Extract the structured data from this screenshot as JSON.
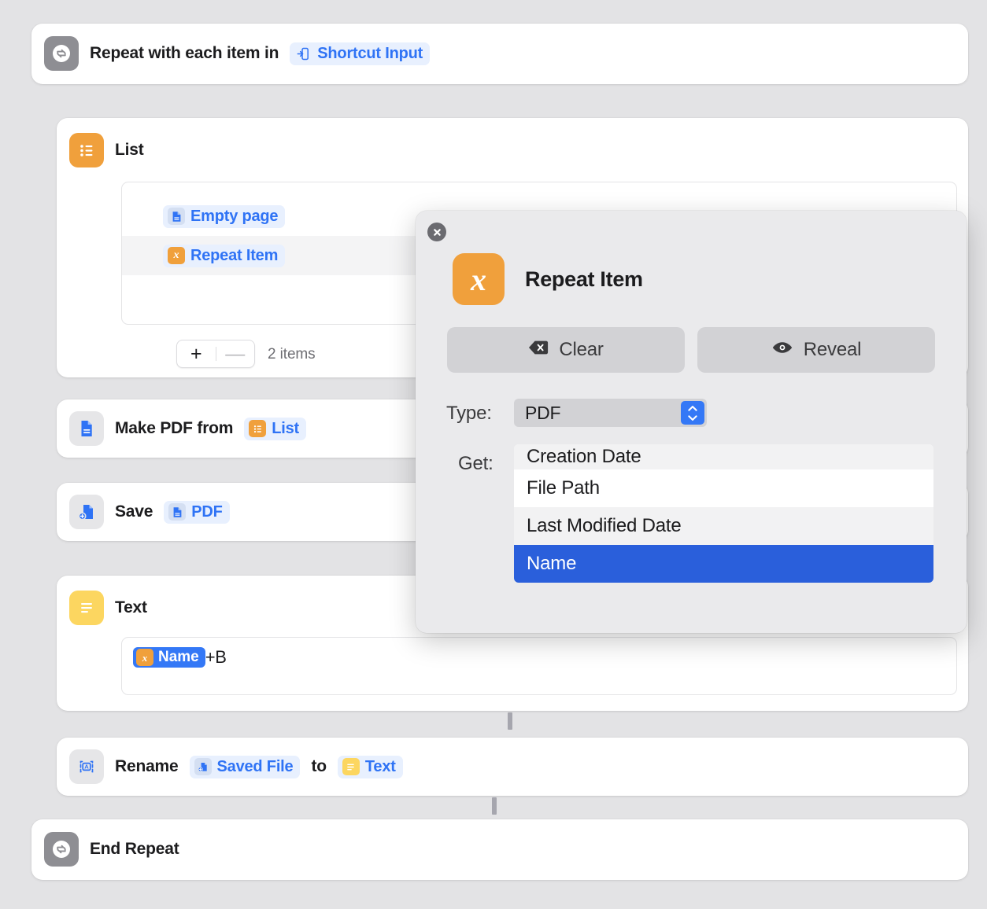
{
  "theme": {
    "page_bg": "#e3e3e5",
    "accent_blue": "#3478f6",
    "token_blue": "#2f73f5",
    "selection_blue": "#2a5fdb",
    "orange": "#f0a03c",
    "yellow": "#fcd660",
    "gray": "#8e8e93"
  },
  "actions": {
    "repeat_start": {
      "label": "Repeat with each item in",
      "icon": "repeat-icon",
      "token": {
        "label": "Shortcut Input",
        "icon": "shortcut-input-icon"
      }
    },
    "list": {
      "label": "List",
      "icon": "list-icon",
      "rows": [
        {
          "label": "Empty page",
          "icon": "document-icon"
        },
        {
          "label": "Repeat Item",
          "icon": "magic-variable-icon"
        }
      ],
      "add_label": "+",
      "remove_label": "—",
      "count_label": "2 items"
    },
    "make_pdf": {
      "label": "Make PDF from",
      "icon": "pdf-document-icon",
      "token": {
        "label": "List",
        "icon": "list-icon"
      }
    },
    "save": {
      "label": "Save",
      "icon": "save-file-icon",
      "token": {
        "label": "PDF",
        "icon": "document-icon"
      }
    },
    "text": {
      "label": "Text",
      "icon": "text-lines-icon",
      "field": {
        "selected_token": {
          "label": "Name",
          "icon": "magic-variable-icon"
        },
        "trailing_text": "+B"
      }
    },
    "rename": {
      "label": "Rename",
      "icon": "rename-icon",
      "token_from": {
        "label": "Saved File",
        "icon": "save-file-icon"
      },
      "connector_word": "to",
      "token_to": {
        "label": "Text",
        "icon": "text-lines-icon"
      }
    },
    "repeat_end": {
      "label": "End Repeat",
      "icon": "repeat-icon"
    }
  },
  "popover": {
    "close_label": "×",
    "icon": "magic-variable-icon",
    "icon_glyph": "x",
    "title": "Repeat Item",
    "buttons": [
      {
        "label": "Clear",
        "icon": "delete-backward-icon"
      },
      {
        "label": "Reveal",
        "icon": "eye-icon"
      }
    ],
    "type": {
      "label": "Type:",
      "value": "PDF",
      "stepper_icon": "chevron-up-down-icon"
    },
    "get": {
      "label": "Get:",
      "options": [
        {
          "label": "Creation Date",
          "selected": false,
          "clipped": true
        },
        {
          "label": "File Path",
          "selected": false,
          "clipped": false
        },
        {
          "label": "Last Modified Date",
          "selected": false,
          "clipped": false
        },
        {
          "label": "Name",
          "selected": true,
          "clipped": false
        }
      ]
    }
  }
}
